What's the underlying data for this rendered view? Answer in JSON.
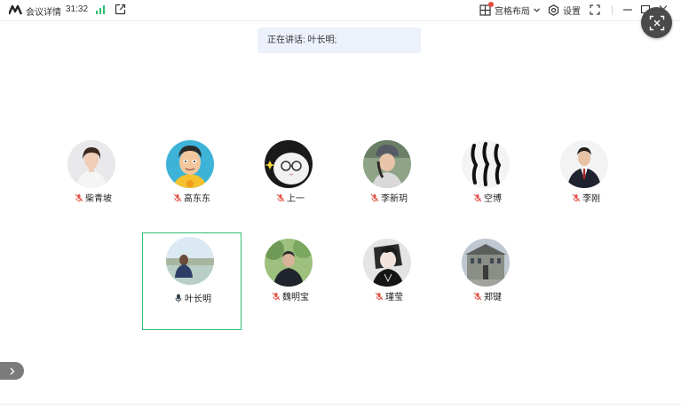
{
  "header": {
    "title": "会议详情",
    "timer": "31:32",
    "layout_label": "宫格布局",
    "settings_label": "设置"
  },
  "speaking": {
    "text": "正在讲话: 叶长明;"
  },
  "participants": [
    {
      "name": "柴青坡",
      "mic": "muted",
      "avatar": "woman-portrait"
    },
    {
      "name": "高东东",
      "mic": "muted",
      "avatar": "cartoon-man"
    },
    {
      "name": "上一",
      "mic": "muted",
      "avatar": "cat-glasses"
    },
    {
      "name": "李新玥",
      "mic": "muted",
      "avatar": "girl-hat"
    },
    {
      "name": "空博",
      "mic": "muted",
      "avatar": "zebra-pattern"
    },
    {
      "name": "李刚",
      "mic": "muted",
      "avatar": "man-suit"
    },
    {
      "name": "叶长明",
      "mic": "speaking",
      "avatar": "man-seaside",
      "active": true
    },
    {
      "name": "魏明宝",
      "mic": "muted",
      "avatar": "man-trees"
    },
    {
      "name": "瑾莹",
      "mic": "muted",
      "avatar": "anime-character"
    },
    {
      "name": "郑键",
      "mic": "muted",
      "avatar": "building"
    }
  ],
  "colors": {
    "active_border": "#2fbf71",
    "muted_icon": "#e0564a",
    "speaking_banner_bg": "#ecf1fb",
    "signal": "#2fbf71",
    "notification_dot": "#e64a3b"
  }
}
